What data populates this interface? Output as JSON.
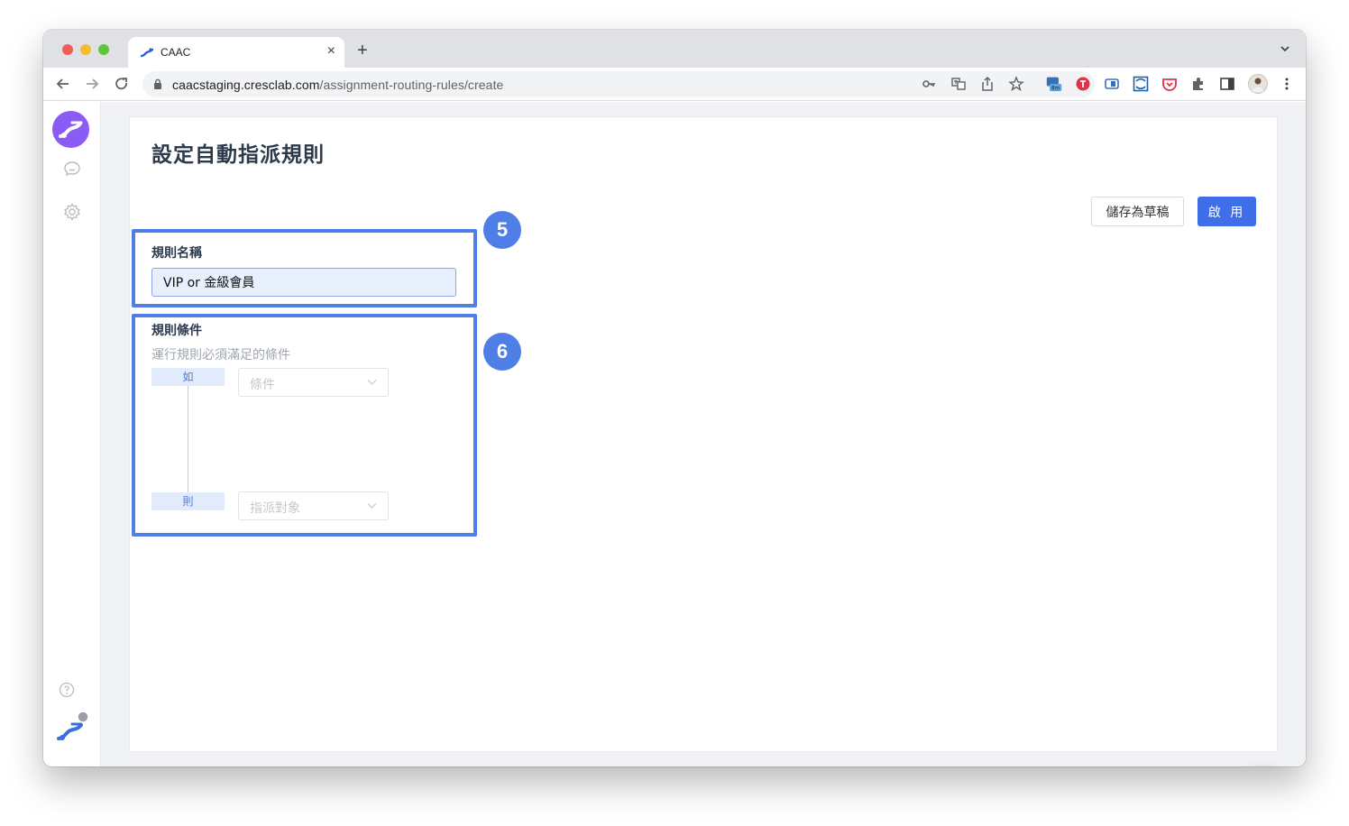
{
  "browser": {
    "tab_title": "CAAC",
    "url_host": "caacstaging.cresclab.com",
    "url_path": "/assignment-routing-rules/create",
    "extension_badge": "8m"
  },
  "page": {
    "title": "設定自動指派規則",
    "save_draft_label": "儲存為草稿",
    "enable_label": "啟 用"
  },
  "rule_name": {
    "label": "規則名稱",
    "value": "VIP or 金級會員"
  },
  "rule_conditions": {
    "label": "規則條件",
    "hint": "運行規則必須滿足的條件",
    "if_tag": "如",
    "then_tag": "則",
    "condition_placeholder": "條件",
    "target_placeholder": "指派對象"
  },
  "annotations": {
    "badge_name": "5",
    "badge_conditions": "6"
  },
  "colors": {
    "brand_purple": "#8a5bf5",
    "primary_blue": "#3f6ee8",
    "highlight_blue": "#4f7ee6",
    "chat_navy": "#213a8f"
  },
  "icons": [
    "back-arrow-icon",
    "forward-arrow-icon",
    "reload-icon",
    "lock-icon",
    "key-icon",
    "translate-icon",
    "share-icon",
    "star-icon",
    "puzzle-icon",
    "chat-icon",
    "gear-icon",
    "help-icon"
  ]
}
